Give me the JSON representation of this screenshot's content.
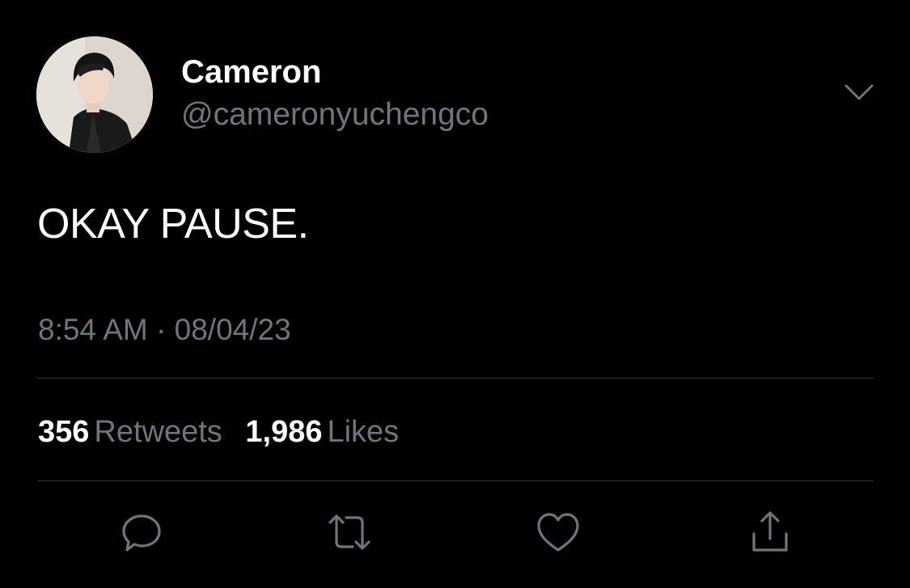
{
  "tweet": {
    "author": {
      "display_name": "Cameron",
      "handle": "@cameronyuchengco"
    },
    "text": "OKAY PAUSE.",
    "timestamp": "8:54 AM · 08/04/23",
    "stats": {
      "retweets_count": "356",
      "retweets_label": "Retweets",
      "likes_count": "1,986",
      "likes_label": "Likes"
    },
    "actions": [
      "reply-icon",
      "retweet-icon",
      "like-icon",
      "share-icon"
    ]
  },
  "colors": {
    "background": "#000000",
    "primary_text": "#ffffff",
    "secondary_text": "#6e767d",
    "divider": "#2f3336"
  }
}
